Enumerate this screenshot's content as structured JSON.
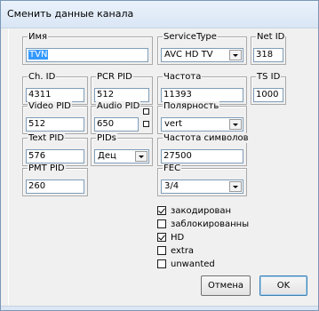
{
  "window": {
    "title": "Сменить данные канала"
  },
  "fields": {
    "name": {
      "label": "Имя",
      "value": "TVN"
    },
    "service_type": {
      "label": "ServiceType",
      "value": "AVC HD TV"
    },
    "net_id": {
      "label": "Net ID",
      "value": "318"
    },
    "ch_id": {
      "label": "Ch. ID",
      "value": "4311"
    },
    "pcr_pid": {
      "label": "PCR PID",
      "value": "512"
    },
    "frequency": {
      "label": "Частота",
      "value": "11393"
    },
    "ts_id": {
      "label": "TS ID",
      "value": "1000"
    },
    "video_pid": {
      "label": "Video PID",
      "value": "512"
    },
    "audio_pid": {
      "label": "Audio PID",
      "value": "650"
    },
    "polarization": {
      "label": "Полярность",
      "value": "vert"
    },
    "text_pid": {
      "label": "Text PID",
      "value": "576"
    },
    "pids": {
      "label": "PIDs",
      "value": "Дец"
    },
    "symbol_rate": {
      "label": "Частота символов",
      "value": "27500"
    },
    "pmt_pid": {
      "label": "PMT PID",
      "value": "260"
    },
    "fec": {
      "label": "FEC",
      "value": "3/4"
    }
  },
  "checkboxes": [
    {
      "label": "закодирован",
      "checked": true
    },
    {
      "label": "заблокированны",
      "checked": false
    },
    {
      "label": "HD",
      "checked": true
    },
    {
      "label": "extra",
      "checked": false
    },
    {
      "label": "unwanted",
      "checked": false
    }
  ],
  "buttons": {
    "cancel": "Отмена",
    "ok": "OK"
  }
}
